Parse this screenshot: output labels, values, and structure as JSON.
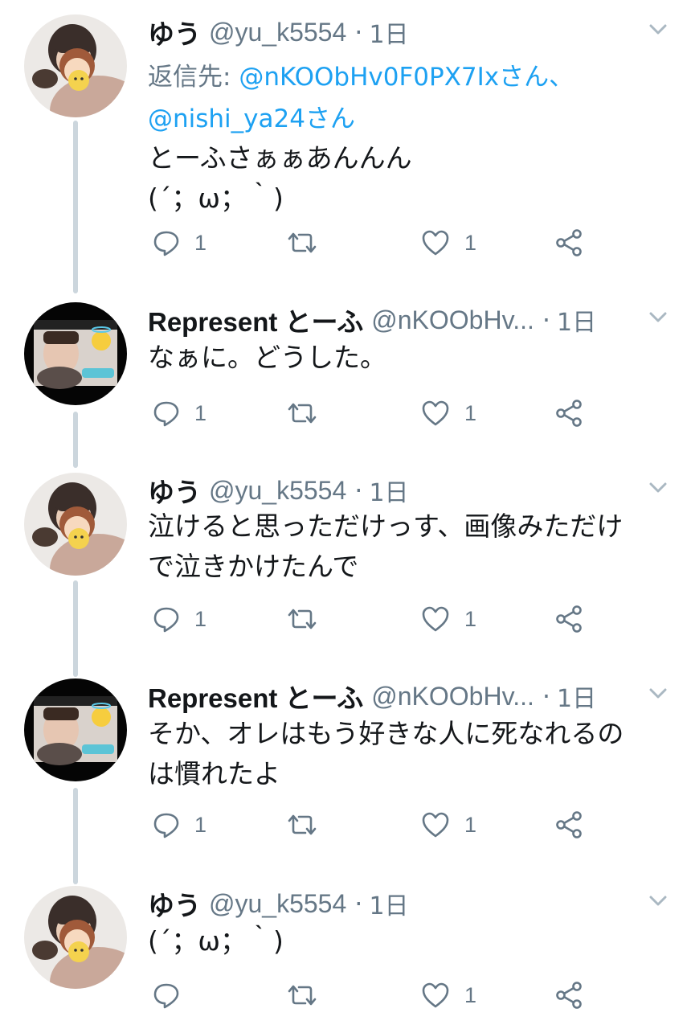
{
  "colors": {
    "link": "#1da1f2",
    "muted": "#657786",
    "thread_line": "#ccd6dd",
    "text": "#14171a"
  },
  "icons": {
    "reply": "reply-icon",
    "retweet": "retweet-icon",
    "like": "heart-icon",
    "share": "share-icon",
    "more": "chevron-down-icon"
  },
  "tweets": [
    {
      "name": "ゆう",
      "handle": "@yu_k5554",
      "time": "1日",
      "reply_label": "返信先:",
      "reply_to_1": "@nKOObHv0F0PX7Ixさん、",
      "reply_to_2": "@nishi_ya24さん",
      "text": "とーふさぁぁあんんん\n(´；ω；｀)",
      "replies": "1",
      "retweets": "",
      "likes": "1"
    },
    {
      "name": "Represent とーふ",
      "handle": "@nKOObHv...",
      "time": "1日",
      "text": "なぁに。どうした。",
      "replies": "1",
      "retweets": "",
      "likes": "1"
    },
    {
      "name": "ゆう",
      "handle": "@yu_k5554",
      "time": "1日",
      "text": "泣けると思っただけっす、画像みただけ\nで泣きかけたんで",
      "replies": "1",
      "retweets": "",
      "likes": "1"
    },
    {
      "name": "Represent とーふ",
      "handle": "@nKOObHv...",
      "time": "1日",
      "text": "そか、オレはもう好きな人に死なれるの\nは慣れたよ",
      "replies": "1",
      "retweets": "",
      "likes": "1"
    },
    {
      "name": "ゆう",
      "handle": "@yu_k5554",
      "time": "1日",
      "text": "(´；ω；｀)",
      "replies": "",
      "retweets": "",
      "likes": "1"
    }
  ]
}
